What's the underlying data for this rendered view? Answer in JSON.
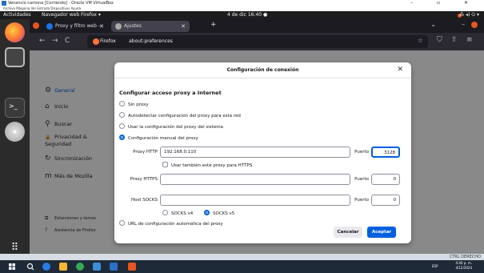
{
  "vm_window": {
    "title": "Venancio camona [Corriendo] - Oracle VM VirtualBox",
    "menu": "Archivo  Máquina  Ver  Entrada  Dispositivos  Ayuda",
    "controls": "–  ▫  ✕"
  },
  "gnome_bar": {
    "activities": "Actividades",
    "app": "Navegador web Firefox ▾",
    "clock": "4 de dic  16:40  ●",
    "tray": "⁂  ◂)  ⏻ ▾"
  },
  "browser": {
    "tabs": [
      {
        "label": "Proxy y filtro web - Venc",
        "close": "✕"
      },
      {
        "label": "Ajustes",
        "close": "✕"
      }
    ],
    "new_tab": "+",
    "tab_list": "⌄",
    "minimize": "–",
    "nav": {
      "back": "←",
      "forward": "→",
      "reload": "C"
    },
    "url_identity": "Firefox",
    "url": "about:preferences",
    "bookmark_star": "☆",
    "toolbar_right": [
      "⛉",
      "⇧",
      "≡"
    ]
  },
  "sidebar": {
    "items": [
      {
        "label": "General",
        "icon": "⚙"
      },
      {
        "label": "Inicio",
        "icon": "⌂"
      },
      {
        "label": "Buscar",
        "icon": "⚲"
      },
      {
        "label": "Privacidad & Seguridad",
        "icon": "🔒"
      },
      {
        "label": "Sincronización",
        "icon": "↻"
      },
      {
        "label": "Más de Mozilla",
        "icon": "m"
      }
    ],
    "footer": [
      {
        "label": "Extensiones y temas",
        "icon": "⧉"
      },
      {
        "label": "Asistencia de Firefox",
        "icon": "?"
      }
    ]
  },
  "dialog": {
    "title": "Configuración de conexión",
    "close": "✕",
    "heading": "Configurar acceso proxy a Internet",
    "options": [
      {
        "label": "Sin proxy",
        "selected": false
      },
      {
        "label": "Autodetectar configuración del proxy para esta red",
        "selected": false
      },
      {
        "label": "Usar la configuración del proxy del sistema",
        "selected": false
      },
      {
        "label": "Configuración manual del proxy",
        "selected": true
      }
    ],
    "http_label": "Proxy HTTP",
    "http_value": "192.168.0.110",
    "http_port_label": "Puerto",
    "http_port_value": "3128",
    "https_checkbox": "Usar también este proxy para HTTPS",
    "https_label": "Proxy HTTPS",
    "https_value": "",
    "https_port_label": "Puerto",
    "https_port_value": "0",
    "socks_label": "Host SOCKS",
    "socks_value": "",
    "socks_port_label": "Puerto",
    "socks_port_value": "0",
    "socks4": "SOCKS v4",
    "socks5": "SOCKS v5",
    "auto_url": "URL de configuración automática del proxy",
    "cancel": "Cancelar",
    "accept": "Aceptar"
  },
  "statusbar": {
    "right_label": "CTRL DERECHO"
  },
  "taskbar": {
    "time": "4:40 p. m.",
    "date": "4/12/2024",
    "lang": "ESP"
  }
}
